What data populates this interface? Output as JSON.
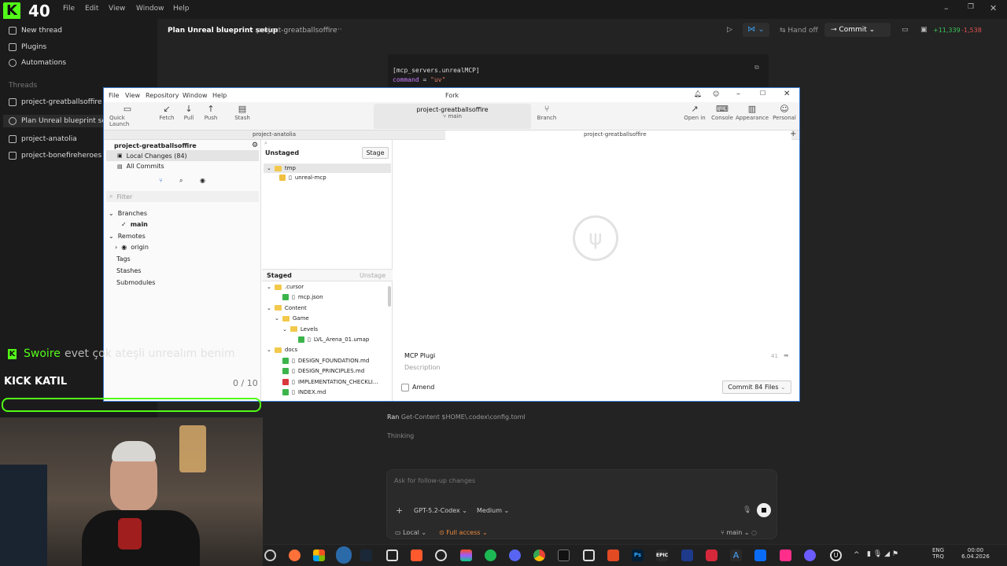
{
  "background_app": {
    "logo_text": "40",
    "menu": [
      "File",
      "Edit",
      "View",
      "Window",
      "Help"
    ],
    "sidebar": {
      "actions": [
        "New thread",
        "Plugins",
        "Automations"
      ],
      "threads_label": "Threads",
      "threads": [
        "project-greatballsoffire",
        "Plan Unreal blueprint setup",
        "project-anatolia",
        "project-bonefireheroes"
      ]
    },
    "header": {
      "title": "Plan Unreal blueprint setup",
      "project": "project-greatballsoffire",
      "more": "···",
      "hand_off": "Hand off",
      "commit": "Commit",
      "diff_add": "+11,339",
      "diff_del": "-1,538"
    },
    "code": {
      "line1": "[mcp_servers.unrealMCP]",
      "line2_key": "command",
      "line2_eq": " = ",
      "line2_val": "\"uv\""
    },
    "log": {
      "ran_prefix": "Ran",
      "ran_cmd": "Get-Content $HOME\\.codex\\config.toml",
      "thinking": "Thinking"
    },
    "composer": {
      "placeholder": "Ask for follow-up changes",
      "model": "GPT-5.2-Codex",
      "effort": "Medium",
      "local": "Local",
      "access": "Full access",
      "branch": "main"
    }
  },
  "fork": {
    "title": "Fork",
    "menu": [
      "File",
      "View",
      "Repository",
      "Window",
      "Help"
    ],
    "toolbar": {
      "quick_launch": "Quick Launch",
      "fetch": "Fetch",
      "pull": "Pull",
      "push": "Push",
      "stash": "Stash",
      "repo_name": "project-greatballsoffire",
      "branch_name": "main",
      "branch": "Branch",
      "open_in": "Open in",
      "console": "Console",
      "appearance": "Appearance",
      "personal": "Personal"
    },
    "tabs": [
      "project-anatolia",
      "project-greatballsoffire"
    ],
    "left": {
      "repo": "project-greatballsoffire",
      "local_changes": "Local Changes (84)",
      "all_commits": "All Commits",
      "filter_placeholder": "Filter",
      "branches": "Branches",
      "main": "main",
      "remotes": "Remotes",
      "origin": "origin",
      "tags": "Tags",
      "stashes": "Stashes",
      "submodules": "Submodules"
    },
    "unstaged": {
      "label": "Unstaged",
      "stage_btn": "Stage",
      "items": [
        {
          "name": "tmp",
          "type": "folder"
        },
        {
          "name": "unreal-mcp",
          "type": "file"
        }
      ]
    },
    "staged": {
      "label": "Staged",
      "unstage_btn": "Unstage",
      "items": [
        {
          "name": ".cursor",
          "type": "folder",
          "level": 0
        },
        {
          "name": "mcp.json",
          "type": "file",
          "status": "added",
          "level": 1
        },
        {
          "name": "Content",
          "type": "folder",
          "level": 0
        },
        {
          "name": "Game",
          "type": "folder",
          "level": 1
        },
        {
          "name": "Levels",
          "type": "folder",
          "level": 2
        },
        {
          "name": "LVL_Arena_01.umap",
          "type": "file",
          "status": "added",
          "level": 3
        },
        {
          "name": "docs",
          "type": "folder",
          "level": 0
        },
        {
          "name": "DESIGN_FOUNDATION.md",
          "type": "file",
          "status": "added",
          "level": 1
        },
        {
          "name": "DESIGN_PRINCIPLES.md",
          "type": "file",
          "status": "added",
          "level": 1
        },
        {
          "name": "IMPLEMENTATION_CHECKLI...",
          "type": "file",
          "status": "deleted",
          "level": 1
        },
        {
          "name": "INDEX.md",
          "type": "file",
          "status": "added",
          "level": 1
        }
      ]
    },
    "commit": {
      "subject": "MCP Plugi",
      "char_count": "41",
      "description_placeholder": "Description",
      "amend": "Amend",
      "commit_btn": "Commit 84 Files"
    }
  },
  "stream": {
    "chat_user": "Swoire",
    "chat_msg": "evet çok ateşli unrealım benim",
    "kick_label": "KICK KATIL",
    "counter": "0 / 10"
  },
  "taskbar": {
    "lang1": "ENG",
    "lang2": "TRQ",
    "time": "00:00",
    "date": "6.04.2026"
  },
  "colors": {
    "accent_blue": "#3a7bd5",
    "kick_green": "#53fc18",
    "added": "#3cb44b",
    "deleted": "#d9363e",
    "folder": "#f2c94c"
  }
}
